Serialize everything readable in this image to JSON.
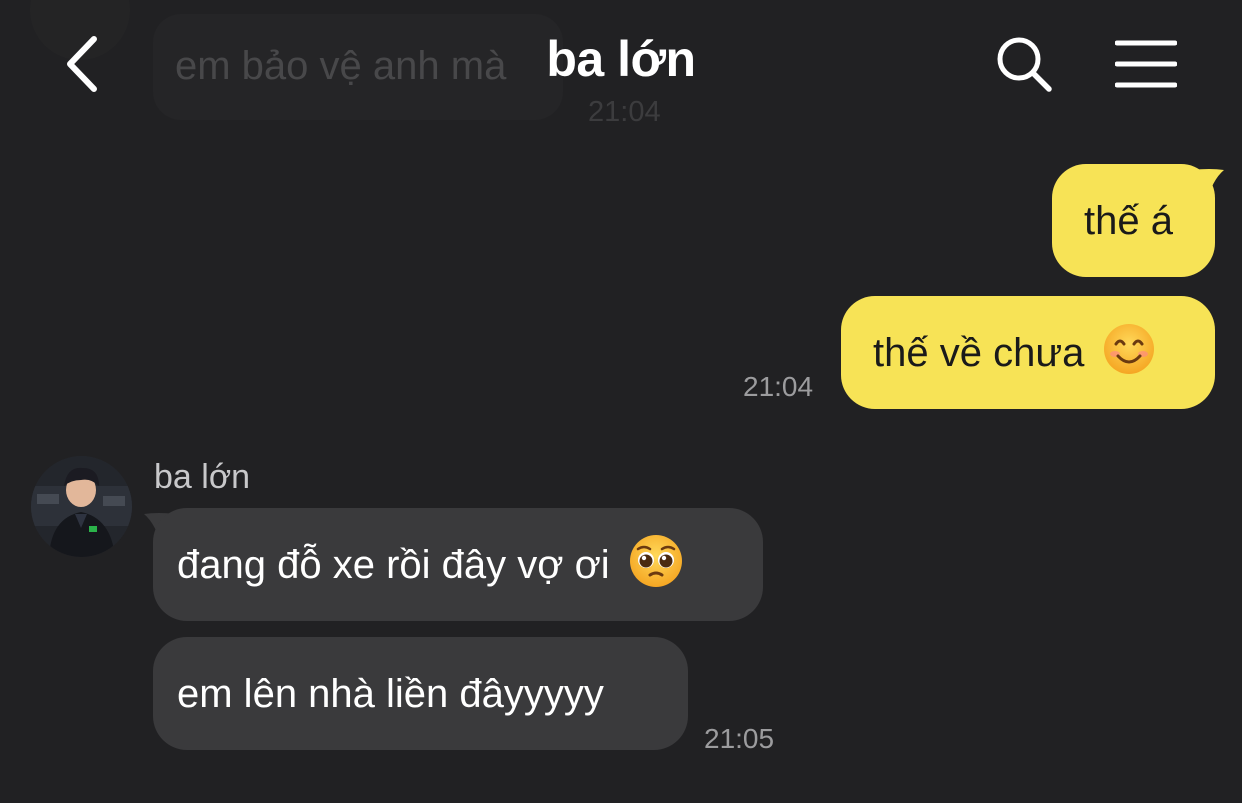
{
  "ghost": {
    "text": "em bảo vệ anh mà",
    "time": "21:04"
  },
  "header": {
    "title": "ba lớn"
  },
  "messages": {
    "mine_1": {
      "text": "thế á"
    },
    "mine_2": {
      "text": "thế về chưa",
      "emoji": "smiling-face-icon",
      "time": "21:04"
    },
    "sender": {
      "name": "ba lớn"
    },
    "theirs_1": {
      "text": "đang đỗ xe rồi đây vợ ơi",
      "emoji": "pleading-face-icon"
    },
    "theirs_2": {
      "text": "em lên nhà liền đâyyyyy",
      "time": "21:05"
    }
  },
  "colors": {
    "background": "#212123",
    "my_bubble": "#f7e356",
    "their_bubble": "#3a3a3c",
    "timestamp": "#9c9c9e"
  }
}
